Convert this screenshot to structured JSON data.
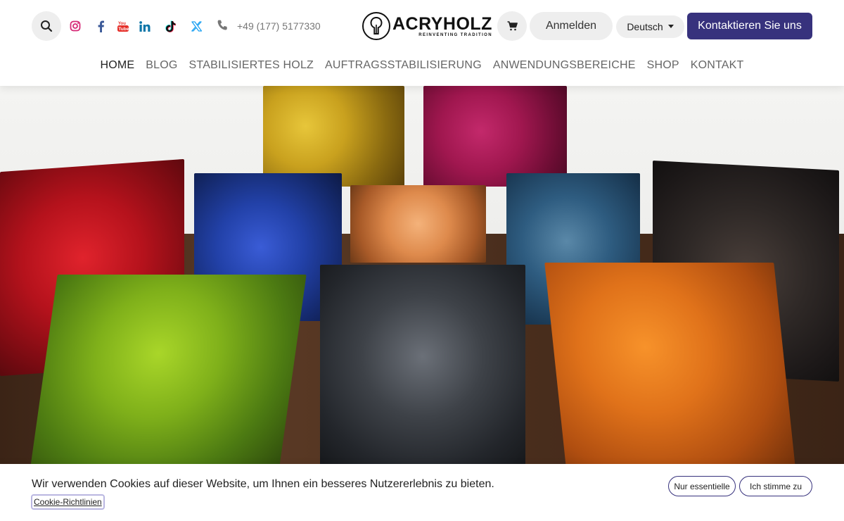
{
  "header": {
    "phone": "+49 (177) 5177330",
    "logo_main": "ACRYHOLZ",
    "logo_sub": "REINVENTING TRADITION",
    "login_label": "Anmelden",
    "language_label": "Deutsch",
    "contact_label": "Kontaktieren Sie uns",
    "accent_color": "#37327d",
    "social_icons": [
      "instagram-icon",
      "facebook-icon",
      "youtube-icon",
      "linkedin-icon",
      "tiktok-icon",
      "x-icon"
    ]
  },
  "nav": {
    "items": [
      {
        "label": "HOME"
      },
      {
        "label": "BLOG"
      },
      {
        "label": "STABILISIERTES HOLZ"
      },
      {
        "label": "AUFTRAGSSTABILISIERUNG"
      },
      {
        "label": "ANWENDUNGSBEREICHE"
      },
      {
        "label": "SHOP"
      },
      {
        "label": "KONTAKT"
      }
    ],
    "active_index": 0
  },
  "cookie": {
    "text": "Wir verwenden Cookies auf dieser Website, um Ihnen ein besseres Nutzererlebnis zu bieten.",
    "policy_link": "Cookie-Richtlinien",
    "essential_label": "Nur essentielle",
    "accept_label": "Ich stimme zu"
  }
}
